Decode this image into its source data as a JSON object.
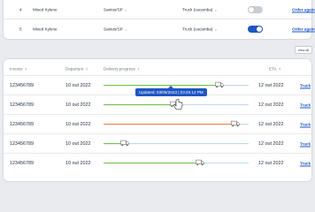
{
  "top_rows": [
    {
      "num": "4",
      "product": "Mixed Xylene",
      "location": "Santos/SP",
      "transport": "Truck (cacamba)",
      "toggle_on": false,
      "link": "Order again"
    },
    {
      "num": "5",
      "product": "Mixed Xylene",
      "location": "Santos/SP",
      "transport": "Truck (cacamba)",
      "toggle_on": true,
      "link": "Order again"
    }
  ],
  "view_all_label": "view all",
  "table": {
    "headers": {
      "invoice": "Invoice",
      "departure": "Departure",
      "progress": "Delivery progress",
      "eta": "ETA"
    },
    "rows": [
      {
        "invoice": "123456789",
        "departure": "10 out 2022",
        "progress": 0.79,
        "status": "green",
        "eta": "12 out 2022",
        "link": "Track"
      },
      {
        "invoice": "123456789",
        "departure": "10 out 2022",
        "progress": 0.48,
        "status": "green",
        "eta": "12 out 2022",
        "link": "Track"
      },
      {
        "invoice": "123456789",
        "departure": "10 out 2022",
        "progress": 0.9,
        "status": "orange",
        "eta": "12 out 2022",
        "link": "Track"
      },
      {
        "invoice": "123456789",
        "departure": "10 out 2022",
        "progress": 0.14,
        "status": "green",
        "eta": "12 out 2022",
        "link": "Track"
      },
      {
        "invoice": "123456789",
        "departure": "10 out 2022",
        "progress": 0.66,
        "status": "green",
        "eta": "12 out 2022",
        "link": "Track"
      }
    ]
  },
  "tooltip_text": "Updated: 03/05/2023 | 03:45:12 PM",
  "colors": {
    "accent": "#1f56c3",
    "green": "#6cbf3a",
    "orange": "#ee7b2e",
    "track": "#b9d3ee"
  }
}
